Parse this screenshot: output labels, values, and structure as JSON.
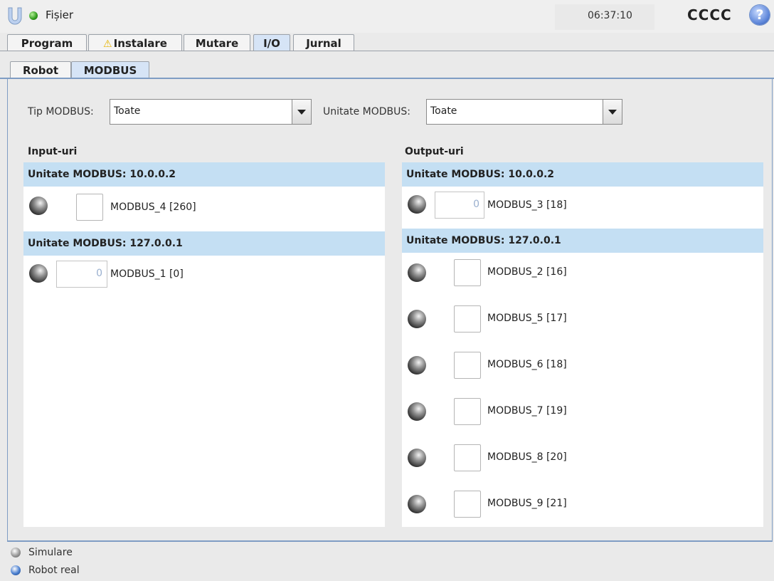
{
  "header": {
    "menu_label": "Fișier",
    "clock": "06:37:10",
    "robot_name": "CCCC",
    "help_label": "?"
  },
  "tabs": [
    {
      "label": "Program"
    },
    {
      "label": "Instalare",
      "warning": true
    },
    {
      "label": "Mutare"
    },
    {
      "label": "I/O",
      "active": true
    },
    {
      "label": "Jurnal"
    }
  ],
  "subtabs": [
    {
      "label": "Robot"
    },
    {
      "label": "MODBUS",
      "active": true
    }
  ],
  "filters": {
    "type_label": "Tip MODBUS:",
    "type_value": "Toate",
    "unit_label": "Unitate MODBUS:",
    "unit_value": "Toate"
  },
  "inputs": {
    "title": "Input-uri",
    "groups": [
      {
        "header": "Unitate MODBUS: 10.0.0.2",
        "signals": [
          {
            "name": "MODBUS_4 [260]",
            "kind": "checkbox"
          }
        ]
      },
      {
        "header": "Unitate MODBUS: 127.0.0.1",
        "signals": [
          {
            "name": "MODBUS_1 [0]",
            "kind": "register",
            "value": "0"
          }
        ]
      }
    ]
  },
  "outputs": {
    "title": "Output-uri",
    "groups": [
      {
        "header": "Unitate MODBUS: 10.0.0.2",
        "signals": [
          {
            "name": "MODBUS_3 [18]",
            "kind": "register",
            "value": "0"
          }
        ]
      },
      {
        "header": "Unitate MODBUS: 127.0.0.1",
        "signals": [
          {
            "name": "MODBUS_2 [16]",
            "kind": "checkbox"
          },
          {
            "name": "MODBUS_5 [17]",
            "kind": "checkbox"
          },
          {
            "name": "MODBUS_6 [18]",
            "kind": "checkbox"
          },
          {
            "name": "MODBUS_7 [19]",
            "kind": "checkbox"
          },
          {
            "name": "MODBUS_8 [20]",
            "kind": "checkbox"
          },
          {
            "name": "MODBUS_9 [21]",
            "kind": "checkbox"
          }
        ]
      }
    ]
  },
  "footer": {
    "sim_label": "Simulare",
    "real_label": "Robot real"
  },
  "colors": {
    "header_bg": "#c4dff3",
    "active_tab": "#d6e4f6",
    "status_green": "#2f9b1c",
    "help_blue": "#5b84d8"
  }
}
